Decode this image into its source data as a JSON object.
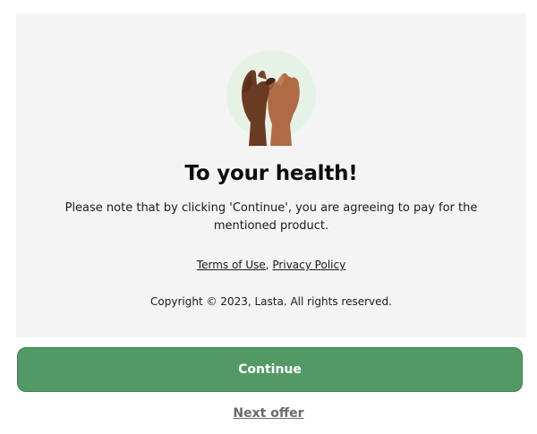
{
  "illustration": {
    "icon": "pinky-promise-hands-icon",
    "circle_color": "#e6f2e6"
  },
  "heading": {
    "title": "To your health!"
  },
  "note": {
    "text": "Please note that by clicking 'Continue', you are agreeing to pay for the mentioned product."
  },
  "legal": {
    "terms_label": "Terms of Use",
    "separator": ",",
    "privacy_label": "Privacy Policy",
    "copyright": "Copyright © 2023, Lasta. All rights reserved."
  },
  "actions": {
    "continue_label": "Continue",
    "next_offer_label": "Next offer",
    "accent_color": "#539965"
  }
}
